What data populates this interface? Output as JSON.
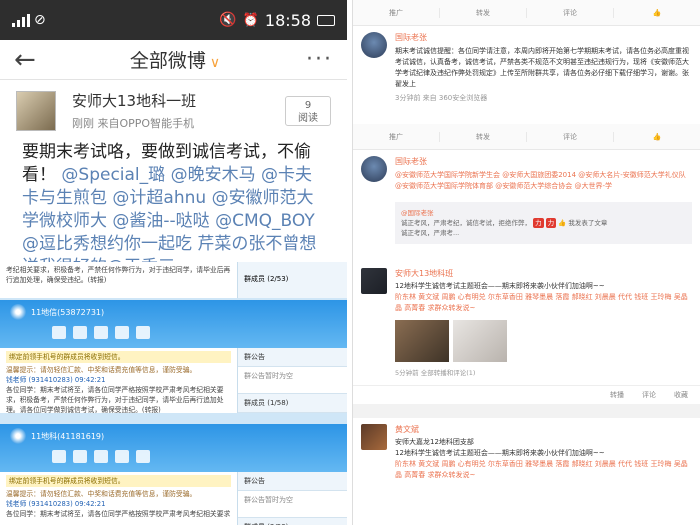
{
  "phone": {
    "status": {
      "time": "18:58"
    },
    "nav": {
      "title": "全部微博",
      "dropdown": "∨",
      "back": "←",
      "more": "···"
    },
    "author": {
      "name": "安师大13地科一班",
      "meta": "刚刚  来自OPPO智能手机"
    },
    "read": {
      "count": "9",
      "label": "阅读"
    },
    "post_plain_1": "要期末考试咯，要做到诚信考试，不偷看！",
    "mentions": [
      "@Special_璐",
      "@晚安木马",
      "@卡夫卡与生煎包",
      "@计超ahnu",
      "@安徽师范大学微校师大",
      "@酱油--哒哒",
      "@CMQ_BOY",
      "@逗比秀想约你一起吃"
    ],
    "post_cut": "芹菜の张不曾想送我很好的@王香三"
  },
  "weibo": {
    "top_actions": [
      "推广",
      "转发",
      "评论",
      "👍"
    ],
    "post1": {
      "name": "国际老张",
      "text": "期末考试诚信提醒：各位同学请注意，本周内即将开始第七学期期末考试，请各位务必高度重视考试诚信，认真备考，诚信考试，严禁各类不规范不文明甚至违纪违规行为，现将《安徽师范大学考试纪律及违纪作弊处罚规定》上传至所附群共享，请各位务必仔细下载仔细学习，谢谢。张翟发上",
      "meta": "3分钟前 来自 360安全浏览器"
    },
    "mid_actions": [
      "推广",
      "转发",
      "评论",
      "👍"
    ],
    "post2": {
      "name": "国际老张",
      "text": "@安徽师范大学国际学院新学生会 @安师大国旅团委2014 @安师大名片-安徽师范大学礼仪队 @安徽师范大学国际学院体育部 @安徽师范大学综合协会 @大世界-学"
    },
    "quote": {
      "name": "@国际老张",
      "text": "诚正考风，严肃考纪，诚信考试，拒绝作弊，",
      "badges": [
        "力",
        "力",
        "👍"
      ],
      "tail": "我发表了文章",
      "line2": "诚正考风，严肃考..."
    }
  },
  "qq": {
    "window1": {
      "title": "11地信(53872731)",
      "announce": "绑定前领手机号的群成员将收到短信。",
      "msg1": "温馨提示：请勿轻信汇款、中奖和话费充值等信息，谨防受骗。",
      "sender1": "钱老师 (931410283) 09:42:21",
      "body1": "各位同学：期末考试将至，请各位同学严格按照学校严肃考风考纪相关要求，积极备考，严禁任何作弊行为，对于违纪同学，请毕业后再行追加处理。请各位同学做到诚信考试，确保受违纪。(转报)",
      "side": {
        "bulletin": "群公告",
        "placeholder": "群公告暂时为空",
        "members": "群成员 (1/58)"
      }
    },
    "window2": {
      "title": "11地科(41181619)",
      "announce": "绑定前领手机号的群成员将收到短信。",
      "msg1": "温馨提示：请勿轻信汇款、中奖和话费充值等信息，谨防受骗。",
      "sender1": "钱老师 (931410283) 09:42:21",
      "body1": "各位同学：期末考试将至，请各位同学严格按照学校严肃考风考纪相关要求",
      "side": {
        "bulletin": "群公告",
        "placeholder": "群公告暂时为空",
        "members": "群成员 (2/53)"
      }
    },
    "top_snip": {
      "text": "考纪相关要求，积极备考，严禁任何作弊行为，对于违纪同学，请毕业后再行追加处理，确保受违纪。(转报)",
      "side": "群成员 (2/53)"
    }
  },
  "feed": {
    "post1": {
      "name": "安师大13地科班",
      "line1": "12地科学生诚信考试主题班会——期末即将来袭小伙伴们加油啊~~",
      "line2": "阶东林 黄文斌 周鹏 心有明兑 尔东草香田 雅琴墨晨 落霞 郝晓红 刘晨晨 代代 钱班 王玲梅 吴晶晶 高菁春 求群众转发说~",
      "meta": "5分钟前 全部转播和评论(1)"
    },
    "actions": [
      "转播",
      "评论",
      "收藏"
    ],
    "post2": {
      "name": "黄文斌",
      "subname": "安师大嘉龙12地科团支部",
      "line1": "12地科学生诚信考试主题班会——期末即将来袭小伙伴们加油啊~~",
      "line2": "阶东林 黄文斌 周鹏 心有明兑 尔东草香田 雅琴墨晨 落霞 郝晓红 刘晨晨 代代 钱班 王玲梅 吴晶晶 高菁春 求群众转发说~"
    }
  }
}
